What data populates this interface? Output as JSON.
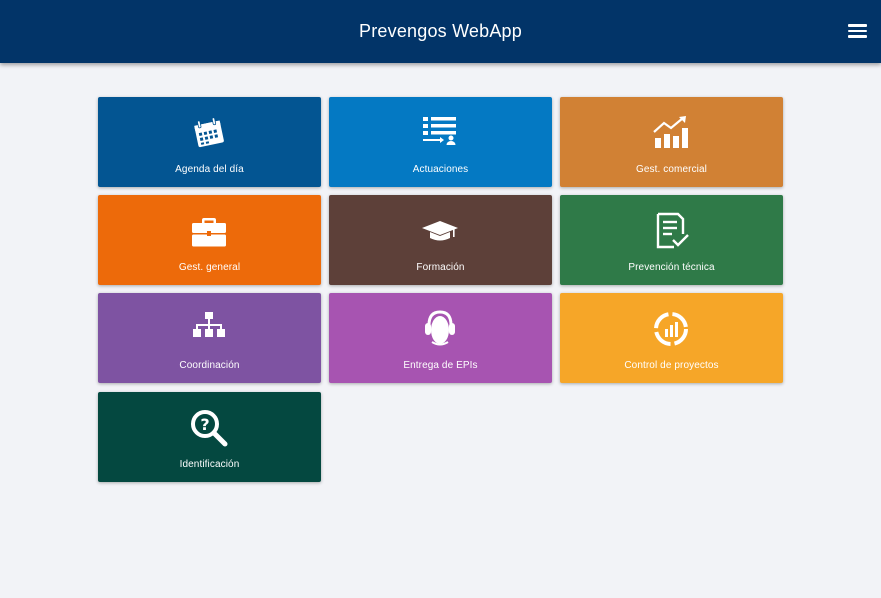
{
  "header": {
    "title": "Prevengos WebApp",
    "menu_icon": "hamburger-menu-icon"
  },
  "tiles": [
    {
      "label": "Agenda del día",
      "color": "#035592",
      "icon": "calendar-icon"
    },
    {
      "label": "Actuaciones",
      "color": "#0479c3",
      "icon": "task-list-icon"
    },
    {
      "label": "Gest. comercial",
      "color": "#d18134",
      "icon": "growth-chart-icon"
    },
    {
      "label": "Gest. general",
      "color": "#ed6a0a",
      "icon": "briefcase-icon"
    },
    {
      "label": "Formación",
      "color": "#5d4039",
      "icon": "graduation-cap-icon"
    },
    {
      "label": "Prevención técnica",
      "color": "#2f7a48",
      "icon": "checked-document-icon"
    },
    {
      "label": "Coordinación",
      "color": "#7e53a2",
      "icon": "org-chart-icon"
    },
    {
      "label": "Entrega de EPIs",
      "color": "#a754b1",
      "icon": "hearing-protection-icon"
    },
    {
      "label": "Control de proyectos",
      "color": "#f6a628",
      "icon": "project-progress-icon"
    },
    {
      "label": "Identificación",
      "color": "#044840",
      "icon": "search-question-icon"
    }
  ]
}
